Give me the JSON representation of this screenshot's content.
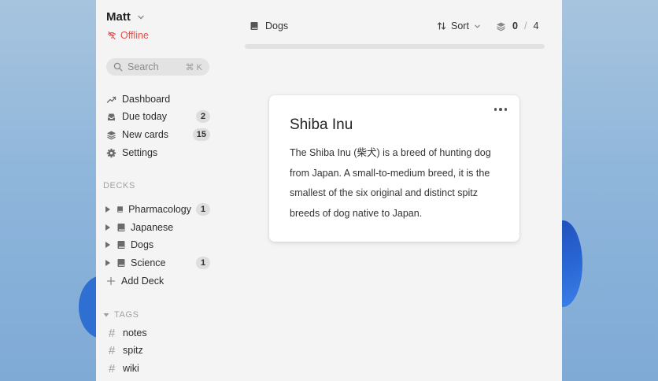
{
  "user": {
    "name": "Matt",
    "status": "Offline"
  },
  "search": {
    "placeholder": "Search",
    "shortcut": "⌘ K"
  },
  "nav": [
    {
      "label": "Dashboard",
      "icon": "trend-icon",
      "badge": ""
    },
    {
      "label": "Due today",
      "icon": "inbox-icon",
      "badge": "2"
    },
    {
      "label": "New cards",
      "icon": "layers-icon",
      "badge": "15"
    },
    {
      "label": "Settings",
      "icon": "gear-icon",
      "badge": ""
    }
  ],
  "decks_label": "DECKS",
  "decks": [
    {
      "label": "Pharmacology",
      "badge": "1"
    },
    {
      "label": "Japanese",
      "badge": ""
    },
    {
      "label": "Dogs",
      "badge": ""
    },
    {
      "label": "Science",
      "badge": "1"
    }
  ],
  "add_deck": "Add Deck",
  "tags_label": "TAGS",
  "tags": [
    "notes",
    "spitz",
    "wiki"
  ],
  "topbar": {
    "deck": "Dogs",
    "sort": "Sort",
    "current": "0",
    "separator": "/",
    "total": "4",
    "progress": 0
  },
  "card": {
    "title": "Shiba Inu",
    "body": "The Shiba Inu (柴犬) is a breed of hunting dog from Japan. A small-to-medium breed, it is the smallest of the six original and distinct spitz breeds of dog native to Japan."
  },
  "colors": {
    "offline": "#d9534f",
    "panel": "#f4f4f4",
    "card": "#ffffff"
  }
}
